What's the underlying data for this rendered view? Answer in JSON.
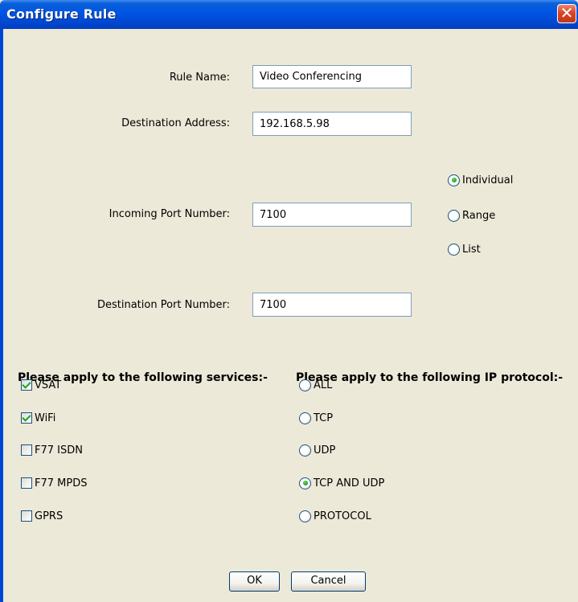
{
  "window": {
    "title": "Configure Rule",
    "close_symbol": "✕"
  },
  "form": {
    "rule_name": {
      "label": "Rule Name:",
      "value": "Video Conferencing"
    },
    "destination_address": {
      "label": "Destination Address:",
      "value": "192.168.5.98"
    },
    "incoming_port": {
      "label": "Incoming Port Number:",
      "value": "7100"
    },
    "destination_port": {
      "label": "Destination Port Number:",
      "value": "7100"
    },
    "port_mode": {
      "options": [
        "Individual",
        "Range",
        "List"
      ],
      "selected": "Individual"
    }
  },
  "services": {
    "heading": "Please apply to the following services:-",
    "items": [
      {
        "label": "VSAT",
        "checked": true
      },
      {
        "label": "WiFi",
        "checked": true
      },
      {
        "label": "F77 ISDN",
        "checked": false
      },
      {
        "label": "F77 MPDS",
        "checked": false
      },
      {
        "label": "GPRS",
        "checked": false
      }
    ]
  },
  "protocol": {
    "heading": "Please apply to the following IP protocol:-",
    "options": [
      "ALL",
      "TCP",
      "UDP",
      "TCP AND UDP",
      "PROTOCOL"
    ],
    "selected": "TCP AND UDP"
  },
  "buttons": {
    "ok": "OK",
    "cancel": "Cancel"
  }
}
